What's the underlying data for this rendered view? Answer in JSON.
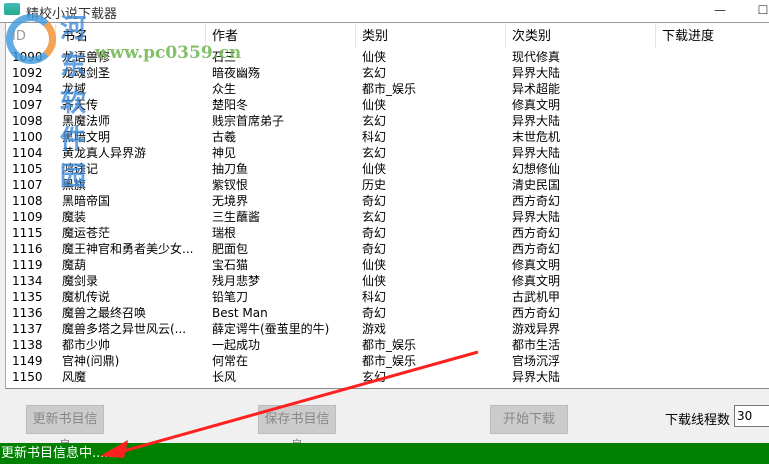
{
  "window": {
    "title": "精校小说下载器",
    "minimize": "—",
    "maximize": "☐"
  },
  "watermark": {
    "title": "河东软件园",
    "url": "www.pc0359.cn"
  },
  "columns": [
    "ID",
    "书名",
    "作者",
    "类别",
    "次类别",
    "下载进度"
  ],
  "rows": [
    [
      "1090",
      "龙语兽修",
      "石三",
      "仙侠",
      "现代修真"
    ],
    [
      "1092",
      "龙魂剑圣",
      "暗夜幽殇",
      "玄幻",
      "异界大陆"
    ],
    [
      "1094",
      "龙域",
      "众生",
      "都市_娱乐",
      "异术超能"
    ],
    [
      "1097",
      "齐天传",
      "楚阳冬",
      "仙侠",
      "修真文明"
    ],
    [
      "1098",
      "黑魔法师",
      "贱宗首席弟子",
      "玄幻",
      "异界大陆"
    ],
    [
      "1100",
      "黑暗文明",
      "古羲",
      "科幻",
      "末世危机"
    ],
    [
      "1104",
      "黄龙真人异界游",
      "神见",
      "玄幻",
      "异界大陆"
    ],
    [
      "1105",
      "鸿途记",
      "抽刀鱼",
      "仙侠",
      "幻想修仙"
    ],
    [
      "1107",
      "黑旗",
      "紫钗恨",
      "历史",
      "清史民国"
    ],
    [
      "1108",
      "黑暗帝国",
      "无境界",
      "奇幻",
      "西方奇幻"
    ],
    [
      "1109",
      "魔装",
      "三生蘸酱",
      "玄幻",
      "异界大陆"
    ],
    [
      "1115",
      "魔运苍茫",
      "瑞根",
      "奇幻",
      "西方奇幻"
    ],
    [
      "1116",
      "魔王神官和勇者美少女...",
      "肥面包",
      "奇幻",
      "西方奇幻"
    ],
    [
      "1119",
      "魔葫",
      "宝石猫",
      "仙侠",
      "修真文明"
    ],
    [
      "1134",
      "魔剑录",
      "残月悲梦",
      "仙侠",
      "修真文明"
    ],
    [
      "1135",
      "魔机传说",
      "铅笔刀",
      "科幻",
      "古武机甲"
    ],
    [
      "1136",
      "魔兽之最终召唤",
      "Best Man",
      "奇幻",
      "西方奇幻"
    ],
    [
      "1137",
      "魔兽多塔之异世风云(...",
      "薛定谔牛(蚕茧里的牛)",
      "游戏",
      "游戏异界"
    ],
    [
      "1138",
      "都市少帅",
      "一起成功",
      "都市_娱乐",
      "都市生活"
    ],
    [
      "1149",
      "官神(问鼎)",
      "何常在",
      "都市_娱乐",
      "官场沉浮"
    ],
    [
      "1150",
      "风魔",
      "长风",
      "玄幻",
      "异界大陆"
    ]
  ],
  "buttons": {
    "update": "更新书目信息",
    "save": "保存书目信息",
    "start": "开始下载"
  },
  "threads": {
    "label": "下载线程数",
    "value": "30"
  },
  "status": "更新书目信息中......",
  "colors": {
    "status_bg": "#008000",
    "arrow": "#ff2020"
  }
}
